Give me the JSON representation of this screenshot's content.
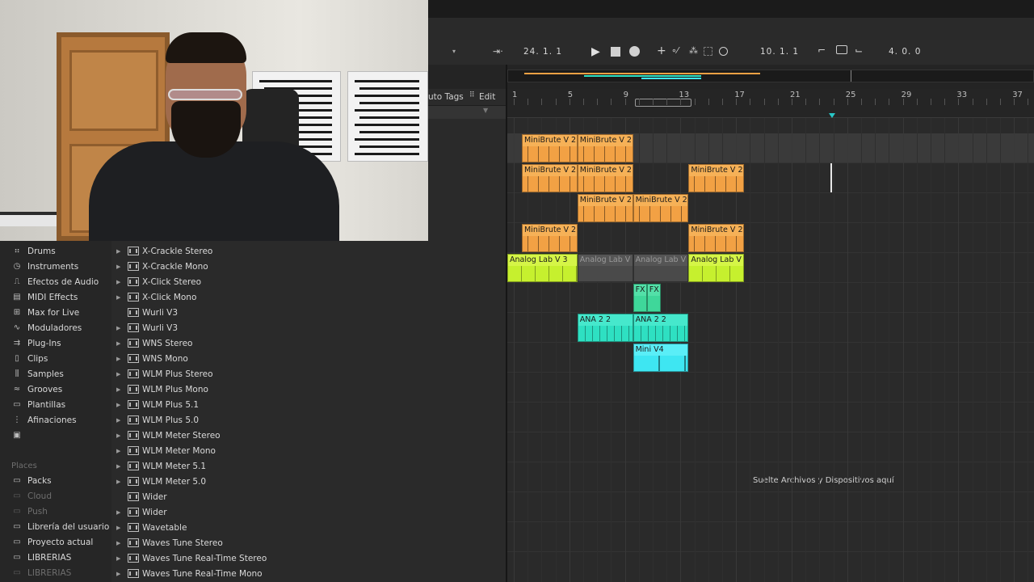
{
  "transport": {
    "position": "24.  1.  1",
    "loop_start": "10.  1.  1",
    "loop_length": "4.  0.  0"
  },
  "browser": {
    "auto_tags_label": "uto Tags",
    "edit_label": "Edit",
    "categories": [
      {
        "label": "Drums",
        "icon": "drums-icon"
      },
      {
        "label": "Instruments",
        "icon": "instruments-icon"
      },
      {
        "label": "Efectos de Audio",
        "icon": "audio-effects-icon"
      },
      {
        "label": "MIDI Effects",
        "icon": "midi-effects-icon"
      },
      {
        "label": "Max for Live",
        "icon": "max-for-live-icon"
      },
      {
        "label": "Moduladores",
        "icon": "modulators-icon"
      },
      {
        "label": "Plug-Ins",
        "icon": "plugins-icon"
      },
      {
        "label": "Clips",
        "icon": "clips-icon"
      },
      {
        "label": "Samples",
        "icon": "samples-icon"
      },
      {
        "label": "Grooves",
        "icon": "grooves-icon"
      },
      {
        "label": "Plantillas",
        "icon": "templates-icon"
      },
      {
        "label": "Afinaciones",
        "icon": "tunings-icon"
      },
      {
        "label": "",
        "icon": "image-icon"
      }
    ],
    "places_header": "Places",
    "places": [
      {
        "label": "Packs",
        "dim": false
      },
      {
        "label": "Cloud",
        "dim": true
      },
      {
        "label": "Push",
        "dim": true
      },
      {
        "label": "Librería del usuario",
        "dim": false
      },
      {
        "label": "Proyecto actual",
        "dim": false
      },
      {
        "label": "LIBRERIAS",
        "dim": false
      },
      {
        "label": "LIBRERIAS",
        "dim": true
      }
    ],
    "items": [
      {
        "label": "X-Crackle Stereo",
        "expandable": true
      },
      {
        "label": "X-Crackle Mono",
        "expandable": true
      },
      {
        "label": "X-Click Stereo",
        "expandable": true
      },
      {
        "label": "X-Click Mono",
        "expandable": true
      },
      {
        "label": "Wurli V3",
        "expandable": false
      },
      {
        "label": "Wurli V3",
        "expandable": true
      },
      {
        "label": "WNS Stereo",
        "expandable": true
      },
      {
        "label": "WNS Mono",
        "expandable": true
      },
      {
        "label": "WLM Plus Stereo",
        "expandable": true
      },
      {
        "label": "WLM Plus Mono",
        "expandable": true
      },
      {
        "label": "WLM Plus 5.1",
        "expandable": true
      },
      {
        "label": "WLM Plus 5.0",
        "expandable": true
      },
      {
        "label": "WLM Meter Stereo",
        "expandable": true
      },
      {
        "label": "WLM Meter Mono",
        "expandable": true
      },
      {
        "label": "WLM Meter 5.1",
        "expandable": true
      },
      {
        "label": "WLM Meter 5.0",
        "expandable": true
      },
      {
        "label": "Wider",
        "expandable": false
      },
      {
        "label": "Wider",
        "expandable": true
      },
      {
        "label": "Wavetable",
        "expandable": true
      },
      {
        "label": "Waves Tune Stereo",
        "expandable": true
      },
      {
        "label": "Waves Tune Real-Time Stereo",
        "expandable": true
      },
      {
        "label": "Waves Tune Real-Time Mono",
        "expandable": true
      }
    ]
  },
  "arrangement": {
    "bar_numbers": [
      "1",
      "5",
      "9",
      "13",
      "17",
      "21",
      "25",
      "29",
      "33",
      "37"
    ],
    "drop_message": "Suelte Archivos y Dispositivos aquí",
    "clips": [
      {
        "lane": 0,
        "start": 1,
        "length": 4,
        "name": "MiniBrute V 2",
        "color": "orange"
      },
      {
        "lane": 0,
        "start": 5,
        "length": 4,
        "name": "MiniBrute V 2",
        "color": "orange"
      },
      {
        "lane": 1,
        "start": 1,
        "length": 4,
        "name": "MiniBrute V 2",
        "color": "orange"
      },
      {
        "lane": 1,
        "start": 5,
        "length": 4,
        "name": "MiniBrute V 2",
        "color": "orange"
      },
      {
        "lane": 1,
        "start": 13,
        "length": 4,
        "name": "MiniBrute V 2",
        "color": "orange"
      },
      {
        "lane": 2,
        "start": 5,
        "length": 4,
        "name": "MiniBrute V 2",
        "color": "orange"
      },
      {
        "lane": 2,
        "start": 9,
        "length": 4,
        "name": "MiniBrute V 2",
        "color": "orange"
      },
      {
        "lane": 3,
        "start": 1,
        "length": 4,
        "name": "MiniBrute V 2",
        "color": "orange"
      },
      {
        "lane": 3,
        "start": 13,
        "length": 4,
        "name": "MiniBrute V 2",
        "color": "orange"
      },
      {
        "lane": 4,
        "start": 0,
        "length": 5,
        "name": "Analog Lab V 3",
        "color": "lime"
      },
      {
        "lane": 4,
        "start": 5,
        "length": 4,
        "name": "Analog Lab V",
        "color": "grey"
      },
      {
        "lane": 4,
        "start": 9,
        "length": 4,
        "name": "Analog Lab V",
        "color": "grey"
      },
      {
        "lane": 4,
        "start": 13,
        "length": 4,
        "name": "Analog Lab V",
        "color": "lime"
      },
      {
        "lane": 5,
        "start": 9,
        "length": 1,
        "name": "FX",
        "color": "green"
      },
      {
        "lane": 5,
        "start": 10,
        "length": 1,
        "name": "FX",
        "color": "green"
      },
      {
        "lane": 6,
        "start": 5,
        "length": 4,
        "name": "ANA 2 2",
        "color": "teal"
      },
      {
        "lane": 6,
        "start": 9,
        "length": 4,
        "name": "ANA 2 2",
        "color": "teal"
      },
      {
        "lane": 7,
        "start": 9,
        "length": 4,
        "name": "Mini V4",
        "color": "cyan"
      }
    ]
  }
}
